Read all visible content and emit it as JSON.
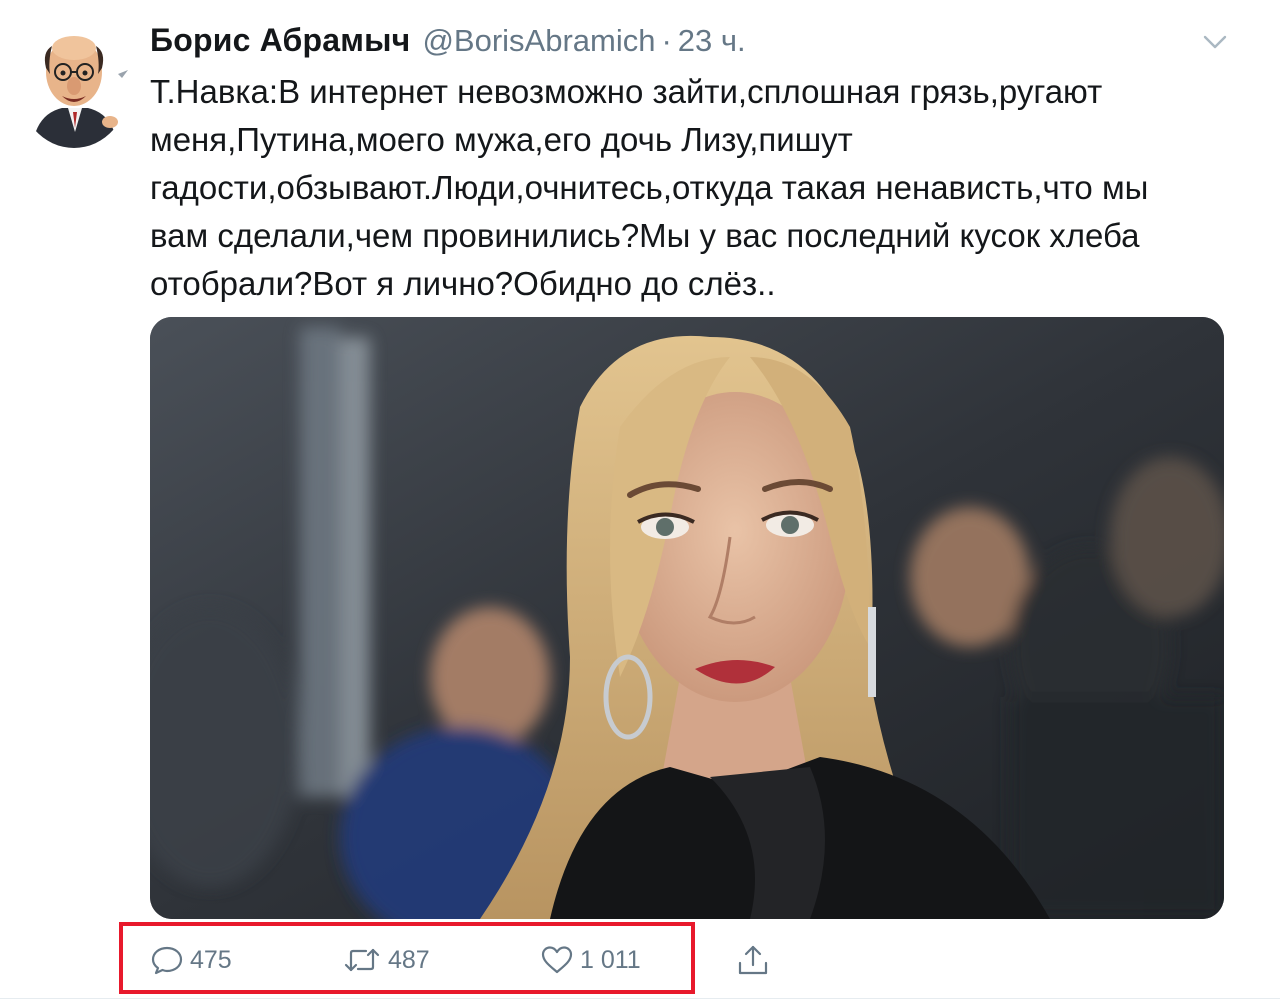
{
  "author": {
    "display_name": "Борис Абрамыч",
    "handle": "@BorisAbramich",
    "separator": "·",
    "time": "23 ч."
  },
  "tweet": {
    "text_lines": [
      "Т.Навка:В интернет невозможно зайти,сплошная грязь,ругают",
      "меня,Путина,моего мужа,его дочь Лизу,пишут",
      "гадости,обзывают.Люди,очнитесь,откуда такая ненависть,что мы",
      "вам сделали,чем провинились?Мы у вас последний кусок хлеба",
      "отобрали?Вот я лично?Обидно до слёз.."
    ]
  },
  "actions": {
    "replies": "475",
    "retweets": "487",
    "likes": "1 011"
  },
  "icons": {
    "reply": "comment-bubble-icon",
    "retweet": "retweet-arrows-icon",
    "like": "heart-icon",
    "share": "share-upload-icon",
    "menu": "chevron-down-icon"
  },
  "colors": {
    "text_primary": "#14171a",
    "text_secondary": "#657786",
    "highlight": "#e8192c"
  }
}
